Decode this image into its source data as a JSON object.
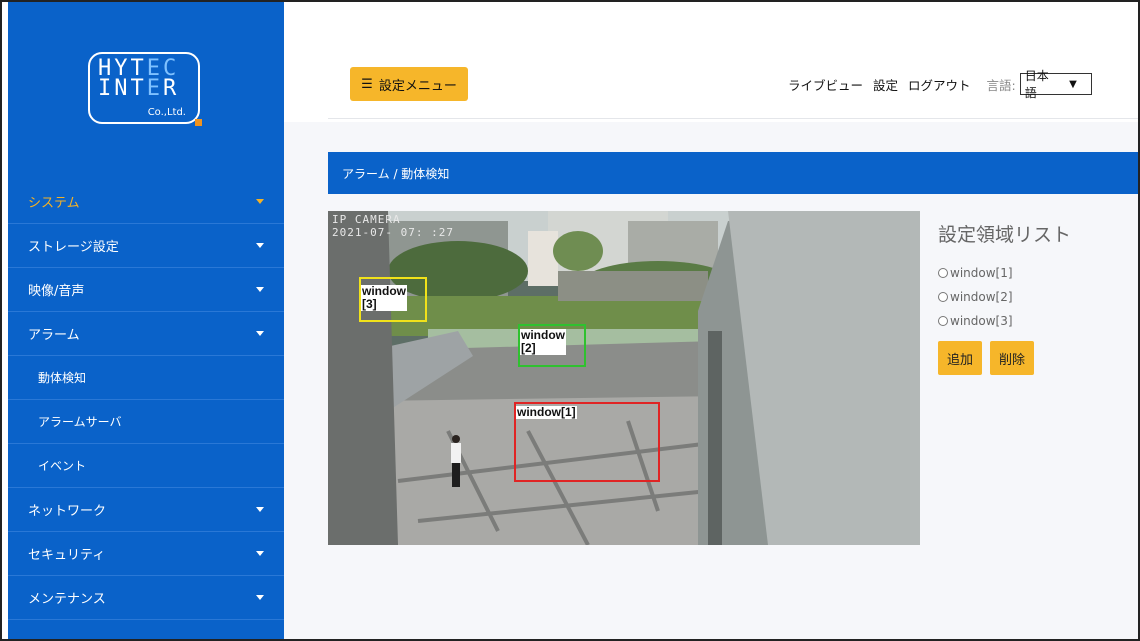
{
  "logo": {
    "line1_a": "HYT",
    "line1_b": "EC",
    "line2_a": "INT",
    "line2_b": "E",
    "line2_c": "R",
    "company": "Co.,Ltd."
  },
  "sidebar": {
    "items": [
      {
        "label": "システム",
        "active": true,
        "has_caret": true
      },
      {
        "label": "ストレージ設定",
        "has_caret": true
      },
      {
        "label": "映像/音声",
        "has_caret": true
      },
      {
        "label": "アラーム",
        "has_caret": true
      },
      {
        "label": "動体検知",
        "sub": true
      },
      {
        "label": "アラームサーバ",
        "sub": true
      },
      {
        "label": "イベント",
        "sub": true
      },
      {
        "label": "ネットワーク",
        "has_caret": true
      },
      {
        "label": "セキュリティ",
        "has_caret": true
      },
      {
        "label": "メンテナンス",
        "has_caret": true
      }
    ]
  },
  "header": {
    "menu_button_icon": "☰",
    "menu_button_label": "設定メニュー",
    "links": {
      "live_view": "ライブビュー",
      "settings": "設定",
      "logout": "ログアウト"
    },
    "language_label": "言語:",
    "language_value": "日本語"
  },
  "breadcrumb": "アラーム / 動体検知",
  "camera": {
    "stamp_line1": "IP CAMERA",
    "stamp_line2": "2021-07-",
    "stamp_line3": "07:  :27",
    "regions": [
      {
        "label": "window[1]",
        "color": "#e02424"
      },
      {
        "label": "window\n[2]",
        "label_a": "window",
        "label_b": "[2]",
        "color": "#2fc12f"
      },
      {
        "label_a": "window",
        "label_b": "[3]",
        "color": "#f0e21a"
      }
    ]
  },
  "region_list": {
    "title": "設定領域リスト",
    "items": [
      "window[1]",
      "window[2]",
      "window[3]"
    ],
    "add_label": "追加",
    "delete_label": "削除"
  },
  "colors": {
    "primary_blue": "#0a62c9",
    "accent_yellow": "#f6b62a",
    "active_nav": "#f3b127"
  }
}
